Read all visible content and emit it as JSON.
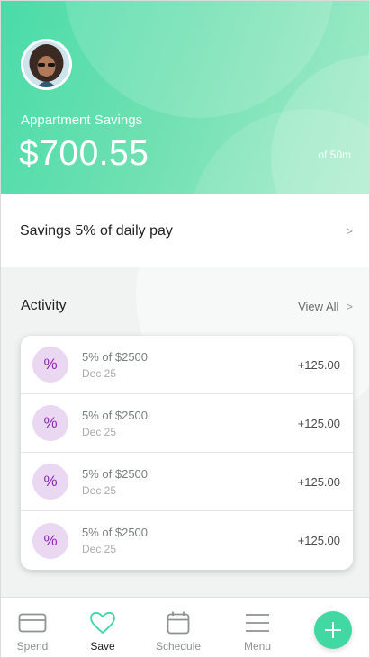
{
  "header": {
    "account_name": "Appartment Savings",
    "balance": "$700.55",
    "goal": "of 50m"
  },
  "savings_rule": {
    "text": "Savings 5% of daily pay",
    "chevron": ">"
  },
  "activity": {
    "title": "Activity",
    "view_all_label": "View All",
    "chevron": ">",
    "items": [
      {
        "icon": "percent-icon",
        "symbol": "%",
        "description": "5% of $2500",
        "date": "Dec 25",
        "amount": "+125.00"
      },
      {
        "icon": "percent-icon",
        "symbol": "%",
        "description": "5% of $2500",
        "date": "Dec 25",
        "amount": "+125.00"
      },
      {
        "icon": "percent-icon",
        "symbol": "%",
        "description": "5% of $2500",
        "date": "Dec 25",
        "amount": "+125.00"
      },
      {
        "icon": "percent-icon",
        "symbol": "%",
        "description": "5% of $2500",
        "date": "Dec 25",
        "amount": "+125.00"
      }
    ]
  },
  "nav": {
    "items": [
      {
        "label": "Spend",
        "icon": "card-icon"
      },
      {
        "label": "Save",
        "icon": "heart-icon",
        "active": true
      },
      {
        "label": "Schedule",
        "icon": "calendar-icon"
      },
      {
        "label": "Menu",
        "icon": "menu-icon"
      }
    ],
    "fab_icon": "plus-icon"
  },
  "colors": {
    "accent": "#41d8a3",
    "hero_start": "#49dca8",
    "hero_end": "#a6ebc9",
    "badge_bg": "#ead7f2",
    "badge_fg": "#8c2bb0",
    "nav_active": "#3fd7a2"
  }
}
